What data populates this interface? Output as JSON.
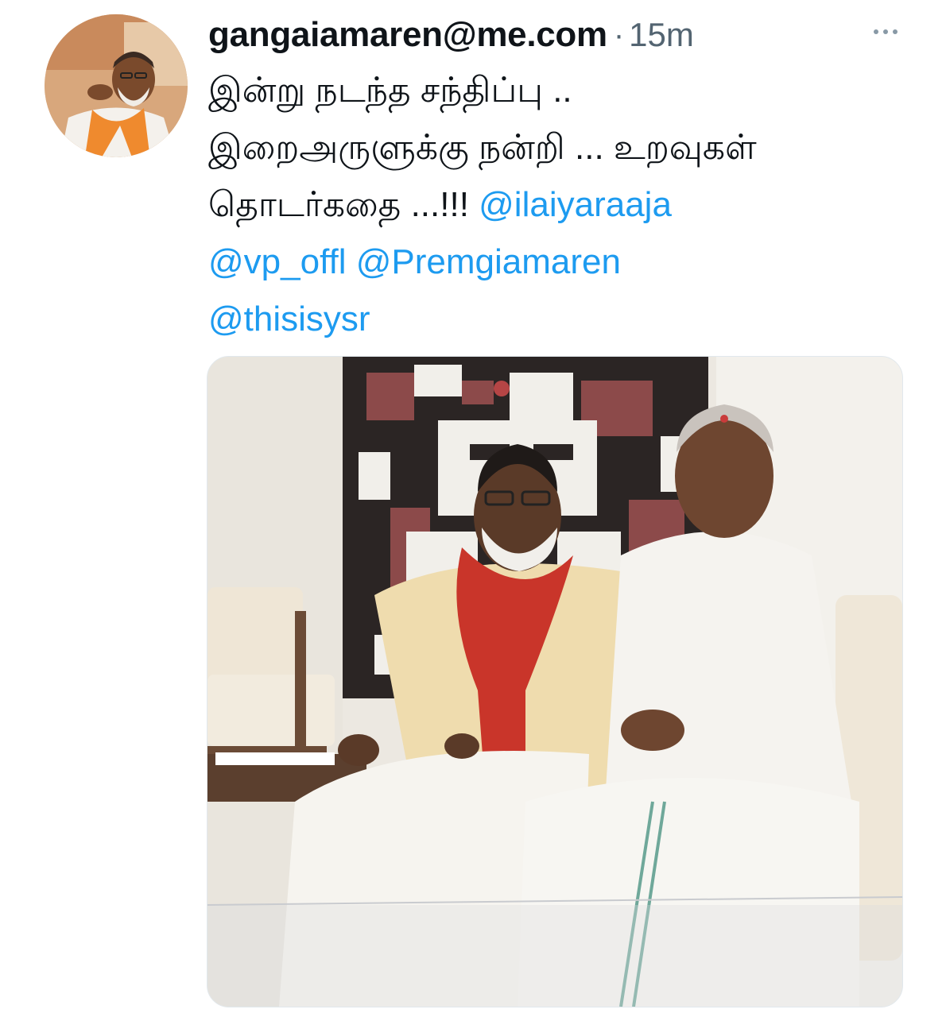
{
  "tweet": {
    "handle": "gangaiamaren@me.com",
    "separator": "·",
    "time": "15m",
    "more_icon": "more-horizontal-icon",
    "text_lines": [
      "இன்று நடந்த சந்திப்பு ..",
      "இறைஅருளுக்கு நன்றி ... உறவுகள்",
      "தொடர்கதை ...!!! "
    ],
    "mentions": [
      "@ilaiyaraaja",
      "@vp_offl",
      "@Premgiamaren",
      "@thisisysr"
    ],
    "colors": {
      "link": "#1d9bf0",
      "text": "#0f1419",
      "secondary": "#536471"
    }
  }
}
